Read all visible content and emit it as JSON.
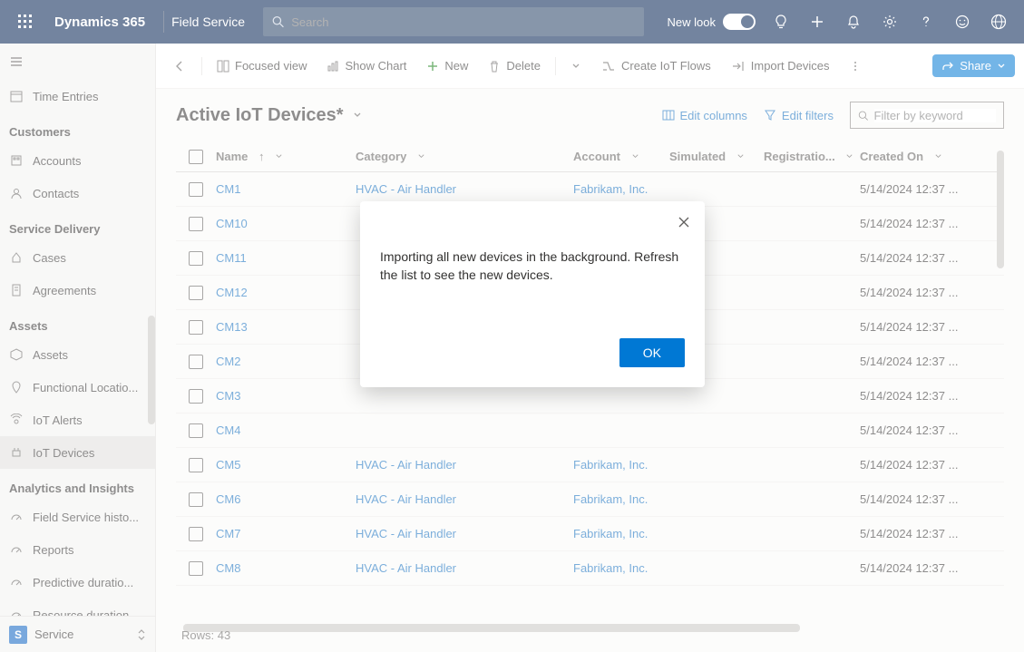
{
  "topbar": {
    "brand": "Dynamics 365",
    "app": "Field Service",
    "search_placeholder": "Search",
    "newlook_label": "New look"
  },
  "sidebar": {
    "time_entries": "Time Entries",
    "section_customers": "Customers",
    "accounts": "Accounts",
    "contacts": "Contacts",
    "section_service_delivery": "Service Delivery",
    "cases": "Cases",
    "agreements": "Agreements",
    "section_assets": "Assets",
    "assets": "Assets",
    "functional_loc": "Functional Locatio...",
    "iot_alerts": "IoT Alerts",
    "iot_devices": "IoT Devices",
    "section_analytics": "Analytics and Insights",
    "fs_history": "Field Service histo...",
    "reports": "Reports",
    "predictive": "Predictive duratio...",
    "resource_dur": "Resource duration...",
    "area_letter": "S",
    "area_label": "Service"
  },
  "cmd": {
    "focused": "Focused view",
    "show_chart": "Show Chart",
    "new": "New",
    "delete": "Delete",
    "create_flows": "Create IoT Flows",
    "import_devices": "Import Devices",
    "share": "Share"
  },
  "view": {
    "title": "Active IoT Devices*",
    "edit_columns": "Edit columns",
    "edit_filters": "Edit filters",
    "filter_placeholder": "Filter by keyword"
  },
  "columns": {
    "name": "Name",
    "category": "Category",
    "account": "Account",
    "simulated": "Simulated",
    "registration": "Registratio...",
    "created": "Created On"
  },
  "rows": [
    {
      "name": "CM1",
      "category": "HVAC - Air Handler",
      "account": "Fabrikam, Inc.",
      "created": "5/14/2024 12:37 ..."
    },
    {
      "name": "CM10",
      "category": "",
      "account": "",
      "created": "5/14/2024 12:37 ..."
    },
    {
      "name": "CM11",
      "category": "",
      "account": "",
      "created": "5/14/2024 12:37 ..."
    },
    {
      "name": "CM12",
      "category": "",
      "account": "",
      "created": "5/14/2024 12:37 ..."
    },
    {
      "name": "CM13",
      "category": "",
      "account": "",
      "created": "5/14/2024 12:37 ..."
    },
    {
      "name": "CM2",
      "category": "",
      "account": "",
      "created": "5/14/2024 12:37 ..."
    },
    {
      "name": "CM3",
      "category": "",
      "account": "",
      "created": "5/14/2024 12:37 ..."
    },
    {
      "name": "CM4",
      "category": "",
      "account": "",
      "created": "5/14/2024 12:37 ..."
    },
    {
      "name": "CM5",
      "category": "HVAC - Air Handler",
      "account": "Fabrikam, Inc.",
      "created": "5/14/2024 12:37 ..."
    },
    {
      "name": "CM6",
      "category": "HVAC - Air Handler",
      "account": "Fabrikam, Inc.",
      "created": "5/14/2024 12:37 ..."
    },
    {
      "name": "CM7",
      "category": "HVAC - Air Handler",
      "account": "Fabrikam, Inc.",
      "created": "5/14/2024 12:37 ..."
    },
    {
      "name": "CM8",
      "category": "HVAC - Air Handler",
      "account": "Fabrikam, Inc.",
      "created": "5/14/2024 12:37 ..."
    }
  ],
  "footer": {
    "rows_label": "Rows: 43"
  },
  "dialog": {
    "text": "Importing all new devices in the background. Refresh the list to see the new devices.",
    "ok": "OK"
  }
}
